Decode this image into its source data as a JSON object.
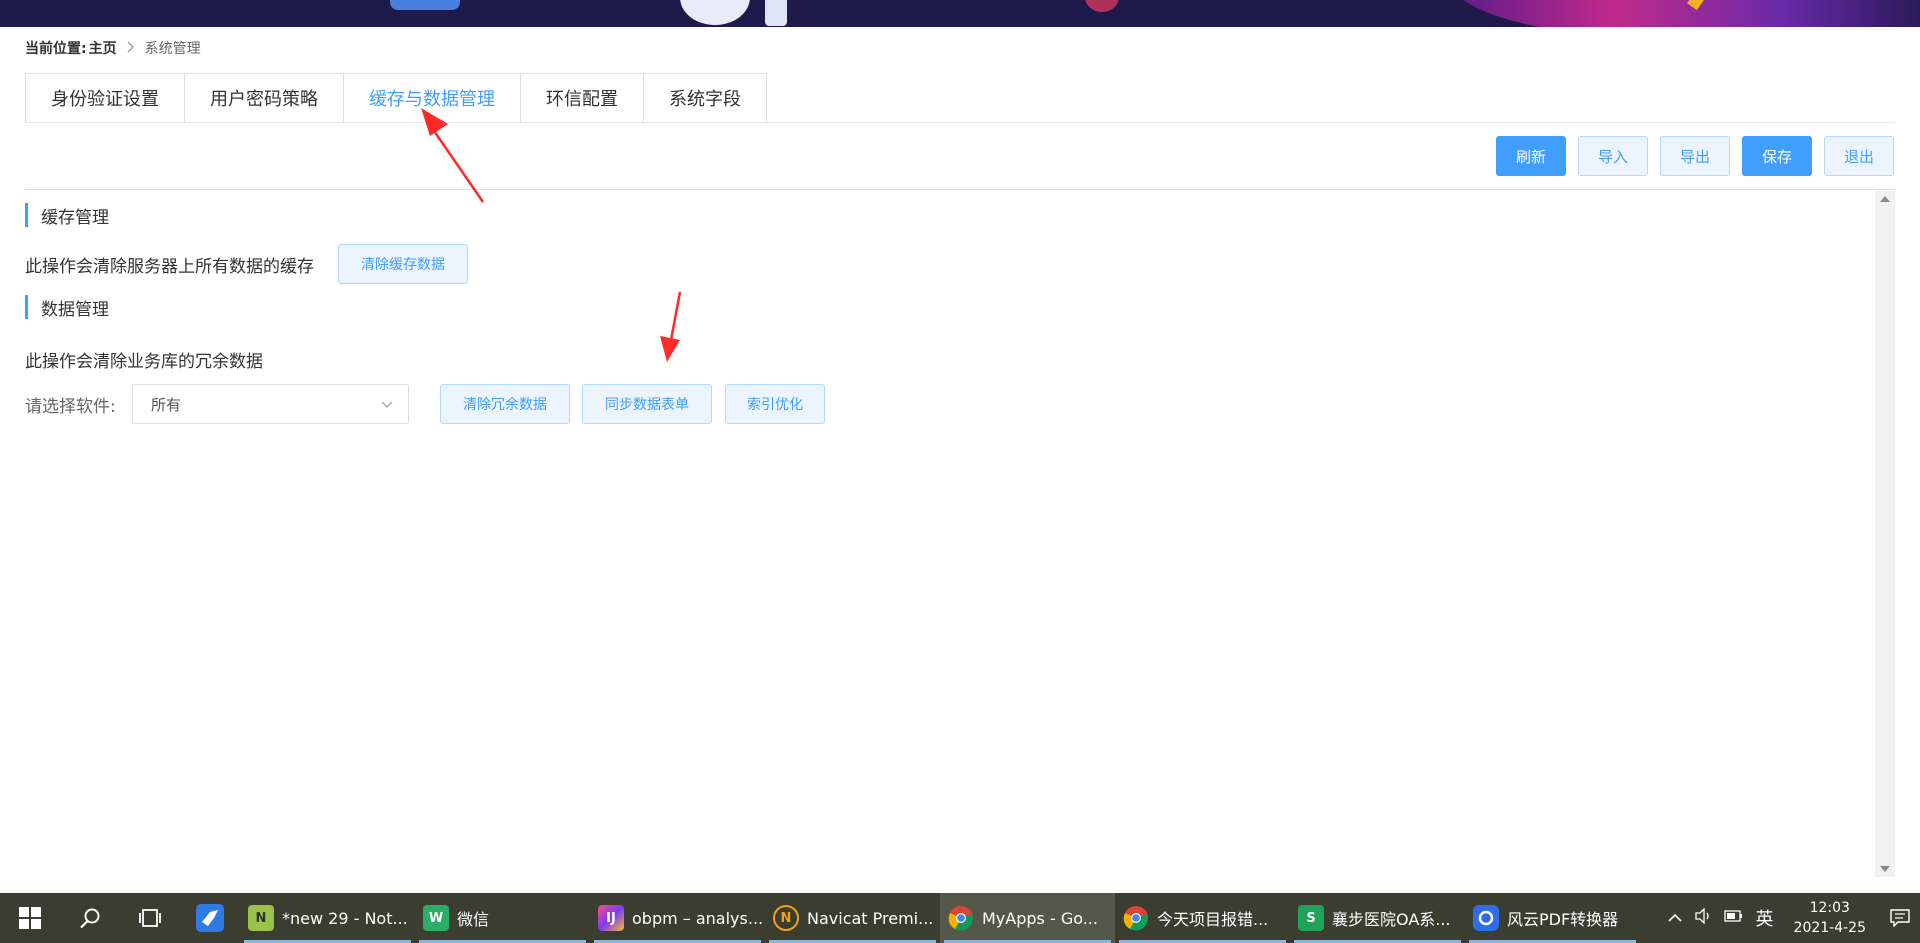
{
  "breadcrumb": {
    "label": "当前位置:",
    "home": "主页",
    "separator": ">",
    "current": "系统管理"
  },
  "tabs": [
    {
      "label": "身份验证设置",
      "active": false
    },
    {
      "label": "用户密码策略",
      "active": false
    },
    {
      "label": "缓存与数据管理",
      "active": true
    },
    {
      "label": "环信配置",
      "active": false
    },
    {
      "label": "系统字段",
      "active": false
    }
  ],
  "toolbar": {
    "refresh": "刷新",
    "import": "导入",
    "export": "导出",
    "save": "保存",
    "exit": "退出"
  },
  "cache": {
    "title": "缓存管理",
    "desc": "此操作会清除服务器上所有数据的缓存",
    "clear_button": "清除缓存数据"
  },
  "data": {
    "title": "数据管理",
    "desc": "此操作会清除业务库的冗余数据",
    "select_label": "请选择软件:",
    "select_value": "所有",
    "clear_redundant": "清除冗余数据",
    "sync_forms": "同步数据表单",
    "index_optimize": "索引优化"
  },
  "colors": {
    "accent": "#409eff",
    "annotation": "#ff2a2a",
    "taskbar": "#3b3d31"
  },
  "taskbar": {
    "apps": [
      {
        "label": "*new 29 - Not...",
        "icon": "notepadpp-icon"
      },
      {
        "label": "微信",
        "icon": "wechat-icon"
      },
      {
        "label": "obpm – analys...",
        "icon": "intellij-icon"
      },
      {
        "label": "Navicat Premi...",
        "icon": "navicat-icon"
      },
      {
        "label": "MyApps - Go...",
        "icon": "chrome-icon",
        "active": true
      },
      {
        "label": "今天项目报错...",
        "icon": "chrome-icon"
      },
      {
        "label": "襄步医院OA系...",
        "icon": "wps-sheet-icon"
      },
      {
        "label": "风云PDF转换器",
        "icon": "pdf-converter-icon"
      }
    ],
    "ime": "英",
    "time": "12:03",
    "date": "2021-4-25"
  }
}
